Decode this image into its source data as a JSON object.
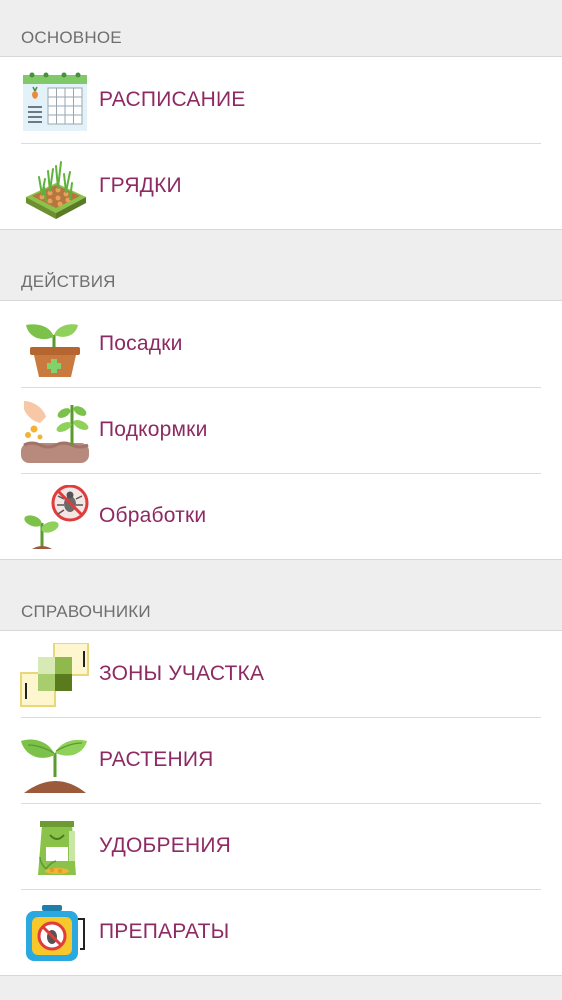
{
  "sections": [
    {
      "header": "ОСНОВНОЕ",
      "items": [
        {
          "label": "РАСПИСАНИЕ",
          "icon": "calendar-schedule-icon"
        },
        {
          "label": "ГРЯДКИ",
          "icon": "garden-bed-icon"
        }
      ]
    },
    {
      "header": "ДЕЙСТВИЯ",
      "items": [
        {
          "label": "Посадки",
          "icon": "seedling-pot-icon"
        },
        {
          "label": "Подкормки",
          "icon": "feeding-hand-icon"
        },
        {
          "label": "Обработки",
          "icon": "pest-control-icon"
        }
      ]
    },
    {
      "header": "СПРАВОЧНИКИ",
      "items": [
        {
          "label": "ЗОНЫ УЧАСТКА",
          "icon": "plot-zones-icon"
        },
        {
          "label": "РАСТЕНИЯ",
          "icon": "sprout-icon"
        },
        {
          "label": "УДОБРЕНИЯ",
          "icon": "fertilizer-bag-icon"
        },
        {
          "label": "ПРЕПАРАТЫ",
          "icon": "sprayer-icon"
        }
      ]
    }
  ],
  "colors": {
    "accent": "#8e2a63",
    "header_text": "#6e6e6e",
    "background": "#eeeeee",
    "card": "#ffffff"
  }
}
